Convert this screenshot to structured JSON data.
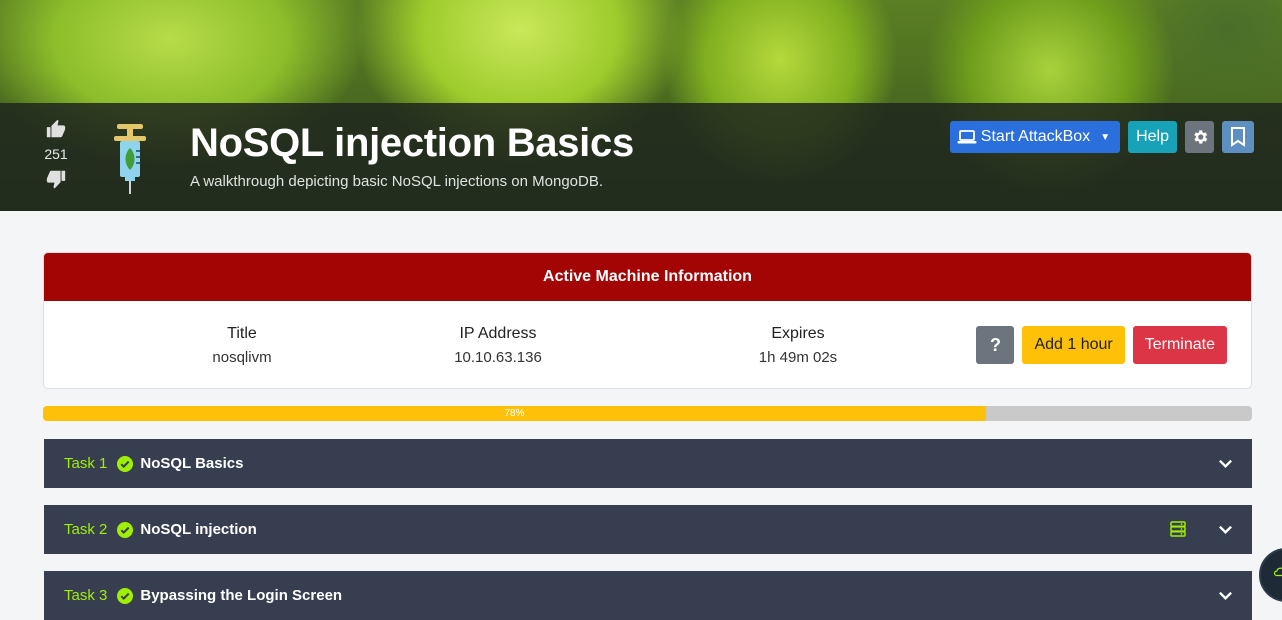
{
  "room": {
    "title": "NoSQL injection Basics",
    "subtitle": "A walkthrough depicting basic NoSQL injections on MongoDB.",
    "votes": "251",
    "icon": "syringe-icon"
  },
  "header_actions": {
    "attackbox_label": "Start AttackBox",
    "help_label": "Help",
    "settings_icon": "gear-icon",
    "bookmark_icon": "bookmark-icon"
  },
  "machine": {
    "header": "Active Machine Information",
    "title_label": "Title",
    "title_value": "nosqlivm",
    "ip_label": "IP Address",
    "ip_value": "10.10.63.136",
    "expires_label": "Expires",
    "expires_value": "1h 49m 02s",
    "help_icon_label": "?",
    "add_hour_label": "Add 1 hour",
    "terminate_label": "Terminate"
  },
  "progress": {
    "percent": 78,
    "label": "78%"
  },
  "tasks": [
    {
      "number": "Task 1",
      "title": "NoSQL Basics",
      "completed": true,
      "has_machine": false
    },
    {
      "number": "Task 2",
      "title": "NoSQL injection",
      "completed": true,
      "has_machine": true
    },
    {
      "number": "Task 3",
      "title": "Bypassing the Login Screen",
      "completed": true,
      "has_machine": false
    }
  ],
  "colors": {
    "machine_header": "#a30505",
    "task_bg": "#373e50",
    "task_number": "#9fef00",
    "progress": "#ffc107",
    "attackbox": "#2a6fdb",
    "help": "#17a2b8"
  }
}
